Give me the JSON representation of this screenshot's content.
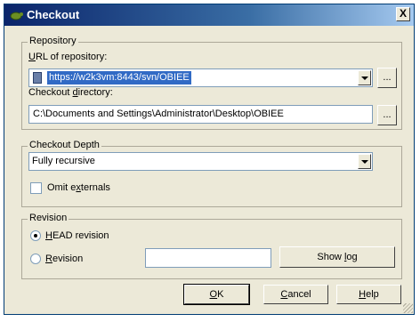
{
  "window": {
    "title": "Checkout",
    "close_glyph": "X"
  },
  "repository": {
    "group_label": "Repository",
    "url_label_u": "U",
    "url_label_rest": "RL of repository:",
    "url_value": "https://w2k3vm:8443/svn/OBIEE",
    "url_browse": "...",
    "dir_label_pre": "Checkout ",
    "dir_label_u": "d",
    "dir_label_rest": "irectory:",
    "dir_value": "C:\\Documents and Settings\\Administrator\\Desktop\\OBIEE",
    "dir_browse": "..."
  },
  "depth": {
    "group_label": "Checkout Depth",
    "selected": "Fully recursive",
    "omit_pre": "Omit e",
    "omit_u": "x",
    "omit_rest": "ternals",
    "omit_checked": false
  },
  "revision": {
    "group_label": "Revision",
    "head_u": "H",
    "head_rest": "EAD revision",
    "rev_u": "R",
    "rev_rest": "evision",
    "rev_value": "",
    "showlog_pre": "Show ",
    "showlog_u": "l",
    "showlog_rest": "og",
    "selected": "head"
  },
  "buttons": {
    "ok_u": "O",
    "ok_rest": "K",
    "cancel_u": "C",
    "cancel_rest": "ancel",
    "help_u": "H",
    "help_rest": "elp"
  },
  "colors": {
    "accent": "#316ac5",
    "titlebar": "#0a246a",
    "face": "#ece9d8"
  },
  "icons": {
    "title": "tortoise-icon",
    "url": "repository-icon"
  }
}
